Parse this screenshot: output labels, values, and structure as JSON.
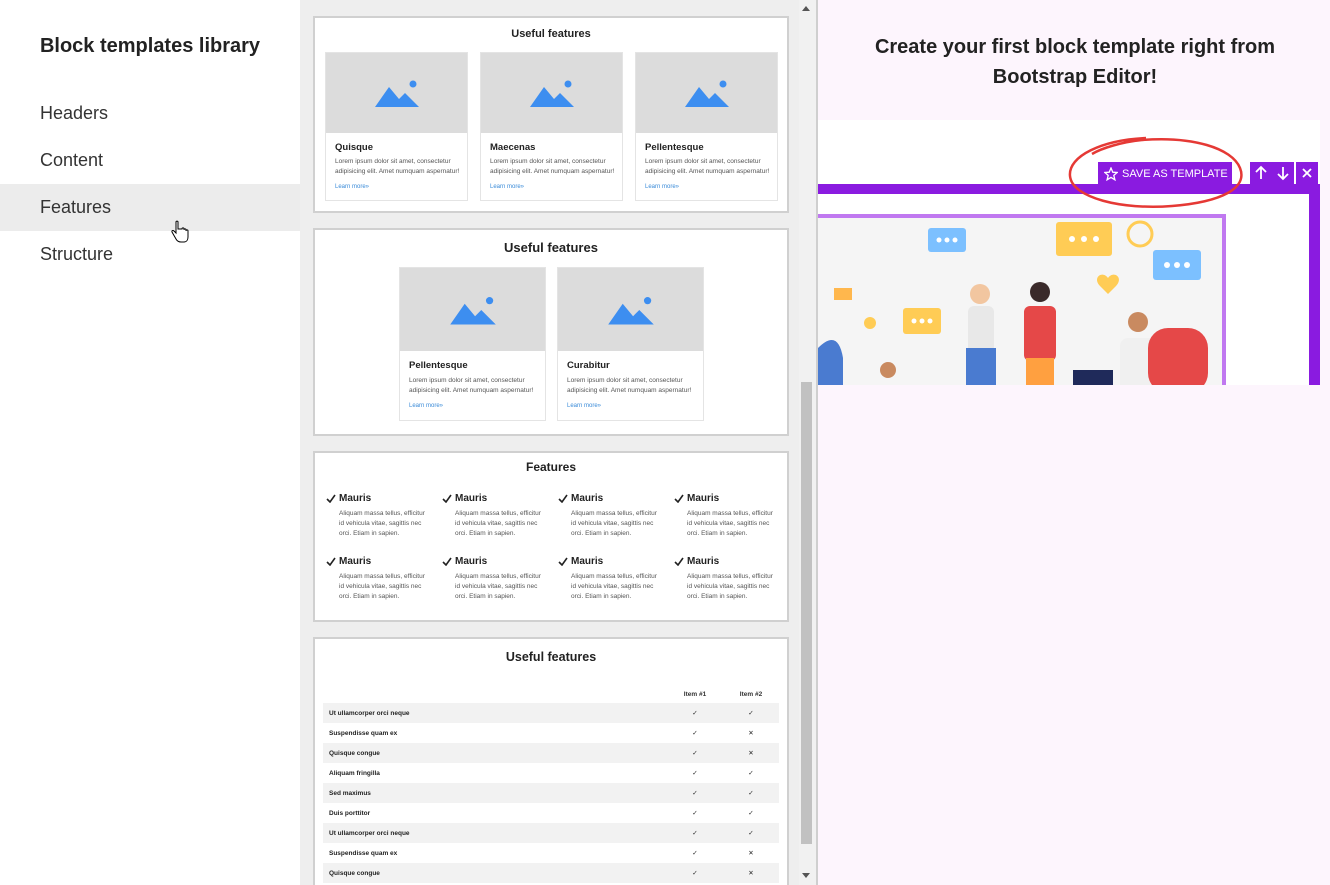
{
  "sidebar": {
    "title": "Block templates library",
    "items": [
      {
        "label": "Headers",
        "active": false
      },
      {
        "label": "Content",
        "active": false
      },
      {
        "label": "Features",
        "active": true
      },
      {
        "label": "Structure",
        "active": false
      }
    ]
  },
  "cards": {
    "card1": {
      "title": "Useful features",
      "items": [
        {
          "name": "Quisque",
          "desc": "Lorem ipsum dolor sit amet, consectetur adipisicing elit. Amet numquam aspernatur!",
          "link": "Learn more»"
        },
        {
          "name": "Maecenas",
          "desc": "Lorem ipsum dolor sit amet, consectetur adipisicing elit. Amet numquam aspernatur!",
          "link": "Learn more»"
        },
        {
          "name": "Pellentesque",
          "desc": "Lorem ipsum dolor sit amet, consectetur adipisicing elit. Amet numquam aspernatur!",
          "link": "Learn more»"
        }
      ]
    },
    "card2": {
      "title": "Useful features",
      "items": [
        {
          "name": "Pellentesque",
          "desc": "Lorem ipsum dolor sit amet, consectetur adipisicing elit. Amet numquam aspernatur!",
          "link": "Learn more»"
        },
        {
          "name": "Curabitur",
          "desc": "Lorem ipsum dolor sit amet, consectetur adipisicing elit. Amet numquam aspernatur!",
          "link": "Learn more»"
        }
      ]
    },
    "card3": {
      "title": "Features",
      "items": [
        {
          "name": "Mauris",
          "desc": "Aliquam massa tellus, efficitur id vehicula vitae, sagittis nec orci. Etiam in sapien."
        },
        {
          "name": "Mauris",
          "desc": "Aliquam massa tellus, efficitur id vehicula vitae, sagittis nec orci. Etiam in sapien."
        },
        {
          "name": "Mauris",
          "desc": "Aliquam massa tellus, efficitur id vehicula vitae, sagittis nec orci. Etiam in sapien."
        },
        {
          "name": "Mauris",
          "desc": "Aliquam massa tellus, efficitur id vehicula vitae, sagittis nec orci. Etiam in sapien."
        },
        {
          "name": "Mauris",
          "desc": "Aliquam massa tellus, efficitur id vehicula vitae, sagittis nec orci. Etiam in sapien."
        },
        {
          "name": "Mauris",
          "desc": "Aliquam massa tellus, efficitur id vehicula vitae, sagittis nec orci. Etiam in sapien."
        },
        {
          "name": "Mauris",
          "desc": "Aliquam massa tellus, efficitur id vehicula vitae, sagittis nec orci. Etiam in sapien."
        },
        {
          "name": "Mauris",
          "desc": "Aliquam massa tellus, efficitur id vehicula vitae, sagittis nec orci. Etiam in sapien."
        }
      ]
    },
    "card4": {
      "title": "Useful features",
      "columns": [
        "Item #1",
        "Item #2"
      ],
      "rows": [
        {
          "name": "Ut ullamcorper orci neque",
          "item1": "✓",
          "item2": "✓"
        },
        {
          "name": "Suspendisse quam ex",
          "item1": "✓",
          "item2": "✕"
        },
        {
          "name": "Quisque congue",
          "item1": "✓",
          "item2": "✕"
        },
        {
          "name": "Aliquam fringilla",
          "item1": "✓",
          "item2": "✓"
        },
        {
          "name": "Sed maximus",
          "item1": "✓",
          "item2": "✓"
        },
        {
          "name": "Duis porttitor",
          "item1": "✓",
          "item2": "✓"
        },
        {
          "name": "Ut ullamcorper orci neque",
          "item1": "✓",
          "item2": "✓"
        },
        {
          "name": "Suspendisse quam ex",
          "item1": "✓",
          "item2": "✕"
        },
        {
          "name": "Quisque congue",
          "item1": "✓",
          "item2": "✕"
        }
      ]
    }
  },
  "right": {
    "title_line1": "Create your first block template right from",
    "title_line2": "Bootstrap Editor!",
    "save_label": "SAVE AS TEMPLATE"
  },
  "colors": {
    "accent": "#8a1be0",
    "frame": "#c078f0",
    "placeholder_icon": "#3d8ef0",
    "check": "#2a9d2a",
    "cross": "#d93030"
  }
}
